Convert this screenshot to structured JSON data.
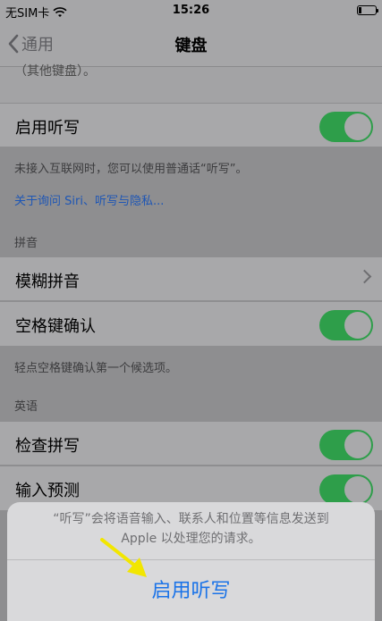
{
  "status_bar": {
    "carrier": "无SIM卡",
    "time": "15:26"
  },
  "nav": {
    "back_label": "通用",
    "title": "键盘"
  },
  "top_clipped_text": "（其他键盘）。",
  "dictation": {
    "label": "启用听写",
    "enabled": true,
    "footer": "未接入互联网时，您可以使用普通话“听写”。",
    "link": "关于询问 Siri、听写与隐私..."
  },
  "pinyin_section": {
    "header": "拼音",
    "fuzzy_label": "模糊拼音",
    "space_confirm_label": "空格键确认",
    "space_confirm_enabled": true,
    "space_confirm_footer": "轻点空格键确认第一个候选项。"
  },
  "english_section": {
    "header": "英语",
    "spell_check_label": "检查拼写",
    "spell_check_enabled": true,
    "predictive_label": "输入预测",
    "predictive_enabled": true
  },
  "alert": {
    "message_line1": "“听写”会将语音输入、联系人和位置等信息发送到",
    "message_line2": "Apple 以处理您的请求。",
    "action_label": "启用听写"
  },
  "colors": {
    "toggle_on": "#2e9e4a",
    "link": "#1e56b5",
    "alert_action": "#1a73e8",
    "annotation_arrow": "#f2e600"
  }
}
